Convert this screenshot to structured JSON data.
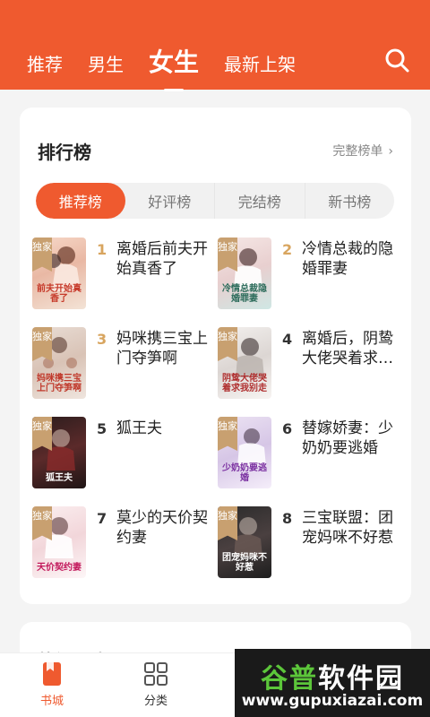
{
  "header": {
    "tabs": [
      {
        "label": "推荐",
        "active": false
      },
      {
        "label": "男生",
        "active": false
      },
      {
        "label": "女生",
        "active": true
      },
      {
        "label": "最新上架",
        "active": false
      }
    ],
    "search_icon": "search-icon",
    "accent": "#ef5a2f"
  },
  "ranking": {
    "title": "排行榜",
    "more_label": "完整榜单",
    "more_chevron": "›",
    "segments": [
      {
        "label": "推荐榜",
        "active": true
      },
      {
        "label": "好评榜",
        "active": false
      },
      {
        "label": "完结榜",
        "active": false
      },
      {
        "label": "新书榜",
        "active": false
      }
    ],
    "exclusive_tag": "独家",
    "books": [
      {
        "rank": "1",
        "title": "离婚后前夫开始真香了",
        "cover_text": "前夫开始真香了"
      },
      {
        "rank": "2",
        "title": "冷情总裁的隐婚罪妻",
        "cover_text": "冷情总裁隐婚罪妻"
      },
      {
        "rank": "3",
        "title": "妈咪携三宝上门夺笋啊",
        "cover_text": "妈咪携三宝上门夺笋啊"
      },
      {
        "rank": "4",
        "title": "离婚后，阴鸷大佬哭着求…",
        "cover_text": "阴鸷大佬哭着求我别走"
      },
      {
        "rank": "5",
        "title": "狐王夫",
        "cover_text": "狐王夫"
      },
      {
        "rank": "6",
        "title": "替嫁娇妻：少奶奶要逃婚",
        "cover_text": "少奶奶要逃婚"
      },
      {
        "rank": "7",
        "title": "莫少的天价契约妻",
        "cover_text": "天价契约妻"
      },
      {
        "rank": "8",
        "title": "三宝联盟：团宠妈咪不好惹",
        "cover_text": "团宠妈咪不好惹"
      }
    ]
  },
  "second_card": {
    "title": "热门分类"
  },
  "bottom_nav": {
    "items": [
      {
        "label": "书城",
        "icon": "book-icon",
        "active": true
      },
      {
        "label": "分类",
        "icon": "grid-icon",
        "active": false
      }
    ]
  },
  "watermark": {
    "brand": "谷普软件园",
    "url": "www.gupuxiazai.com"
  }
}
